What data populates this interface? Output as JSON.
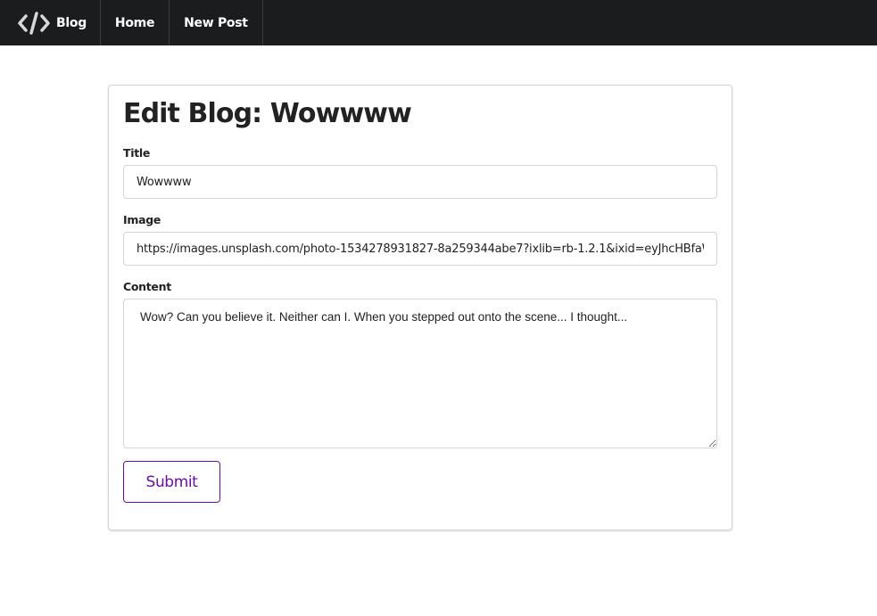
{
  "navbar": {
    "brand_icon": "code-icon",
    "brand_label": "Blog",
    "home_label": "Home",
    "new_post_label": "New Post"
  },
  "form": {
    "heading": "Edit Blog: Wowwww",
    "title_label": "Title",
    "title_value": "Wowwww",
    "image_label": "Image",
    "image_value": "https://images.unsplash.com/photo-1534278931827-8a259344abe7?ixlib=rb-1.2.1&ixid=eyJhcHBfaWQ",
    "content_label": "Content",
    "content_value": "Wow? Can you believe it. Neither can I. When you stepped out onto the scene... I thought...",
    "submit_label": "Submit"
  },
  "colors": {
    "navbar_bg": "#1b1c1d",
    "accent": "#6a0dad",
    "border": "#d4d4d5"
  }
}
